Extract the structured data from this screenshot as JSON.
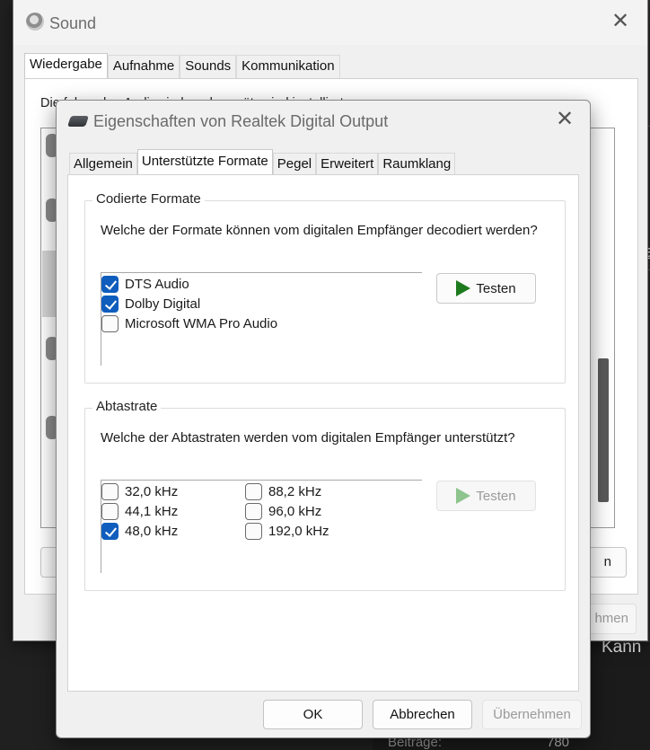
{
  "background": {
    "fragments": [
      "te",
      "a",
      "n",
      "hmen",
      "Kann",
      "Beiträge:",
      "780"
    ]
  },
  "sound_window": {
    "title": "Sound",
    "close_glyph": "✕",
    "tabs": [
      "Wiedergabe",
      "Aufnahme",
      "Sounds",
      "Kommunikation"
    ],
    "description": "Die folgenden Audiowiedergabegeräte sind installiert:"
  },
  "dialog": {
    "title": "Eigenschaften von Realtek Digital Output",
    "close_glyph": "✕",
    "tabs": [
      "Allgemein",
      "Unterstützte Formate",
      "Pegel",
      "Erweitert",
      "Raumklang"
    ],
    "encoded": {
      "legend": "Codierte Formate",
      "question": "Welche der Formate können vom digitalen Empfänger decodiert werden?",
      "formats": [
        {
          "label": "DTS Audio",
          "checked": true
        },
        {
          "label": "Dolby Digital",
          "checked": true
        },
        {
          "label": "Microsoft WMA Pro Audio",
          "checked": false
        }
      ],
      "test_label": "Testen"
    },
    "sample_rate": {
      "legend": "Abtastrate",
      "question": "Welche der Abtastraten werden vom digitalen Empfänger unterstützt?",
      "rates": [
        {
          "label": "32,0 kHz",
          "checked": false
        },
        {
          "label": "44,1 kHz",
          "checked": false
        },
        {
          "label": "48,0 kHz",
          "checked": true
        },
        {
          "label": "88,2 kHz",
          "checked": false
        },
        {
          "label": "96,0 kHz",
          "checked": false
        },
        {
          "label": "192,0 kHz",
          "checked": false
        }
      ],
      "test_label": "Testen"
    },
    "buttons": {
      "ok": "OK",
      "cancel": "Abbrechen",
      "apply": "Übernehmen"
    }
  },
  "colors": {
    "checkbox_accent": "#0f5dbd",
    "play_icon": "#1e7a1e"
  }
}
